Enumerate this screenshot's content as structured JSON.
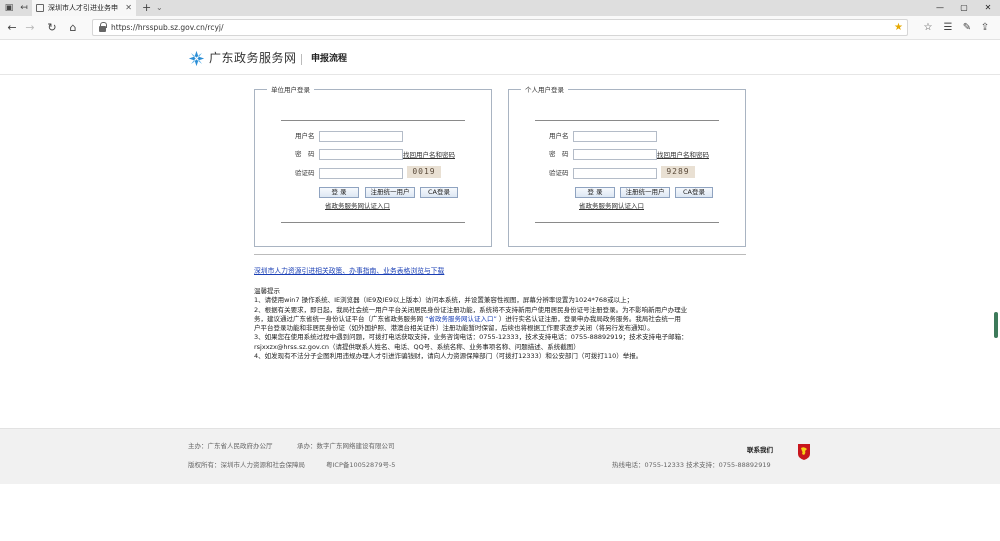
{
  "browser": {
    "tab_title": "深圳市人才引进业务申",
    "url": "https://hrsspub.sz.gov.cn/rcyj/"
  },
  "header": {
    "logo_text": "广东政务服务网",
    "subtitle": "申报流程"
  },
  "unit_login": {
    "legend": "单位用户登录",
    "username_label": "用户名",
    "password_label": "密　码",
    "recover_link": "找回用户名和密码",
    "captcha_label": "验证码",
    "captcha_code": "0019",
    "login_button": "登 录",
    "register_button": "注册统一用户",
    "ca_button": "CA登录",
    "cert_link": "省政务服务网认证入口"
  },
  "personal_login": {
    "legend": "个人用户登录",
    "username_label": "用户名",
    "password_label": "密　码",
    "recover_link": "找回用户名和密码",
    "captcha_label": "验证码",
    "captcha_code": "9289",
    "login_button": "登 录",
    "register_button": "注册统一用户",
    "ca_button": "CA登录",
    "cert_link": "省政务服务网认证入口"
  },
  "policy_link": "深圳市人力资源引进相关政策、办事指南、业务表格浏览与下载",
  "notice": {
    "title": "温馨提示",
    "line1": "1、请使用win7 操作系统、IE浏览器（IE9及IE9以上版本）访问本系统，并设置兼容性视图，屏幕分辨率设置为1024*768或以上；",
    "line2a": "2、根据有关要求，即日起，我局社会统一用户平台关闭居民身份证注册功能，系统将不支持新用户使用居民身份证号注册登录。为不影响新用户办理业",
    "line2b_pre": "务，建议通过广东省统一身份认证平台（广东省政务服务网 ",
    "line2b_link": "“省政务服务网认证入口”",
    "line2b_post": " ）进行实名认证注册，登录申办我局政务服务。我局社会统一用",
    "line2c": "户平台登录功能和非居民身份证（如外国护照、港澳台相关证件）注册功能暂时保留，后续也将根据工作要求逐步关闭（将另行发布通知）。",
    "line3a": "3、如果您在使用系统过程中遇到问题，可拨打电话获取支持，业务咨询电话：0755-12333，技术支持电话：0755-88892919；技术支持电子邮箱：",
    "line3b": "rsjxxzx@hrss.sz.gov.cn（请提供联系人姓名、电话、QQ号、系统名称、业务事项名称、问题描述、系统截图）",
    "line4": "4、如发现有不法分子企图利用违规办理人才引进诈骗钱财，请向人力资源保障部门（可拨打12333）和公安部门（可拨打110）举报。"
  },
  "footer": {
    "sponsor": "主办：广东省人民政府办公厅",
    "organizer": "承办：数字广东网络建设有限公司",
    "copyright": "版权所有：深圳市人力资源和社会保障局",
    "icp": "粤ICP备10052879号-5",
    "contact_label": "联系我们",
    "hotline": "热线电话：0755-12333 技术支持：0755-88892919"
  }
}
